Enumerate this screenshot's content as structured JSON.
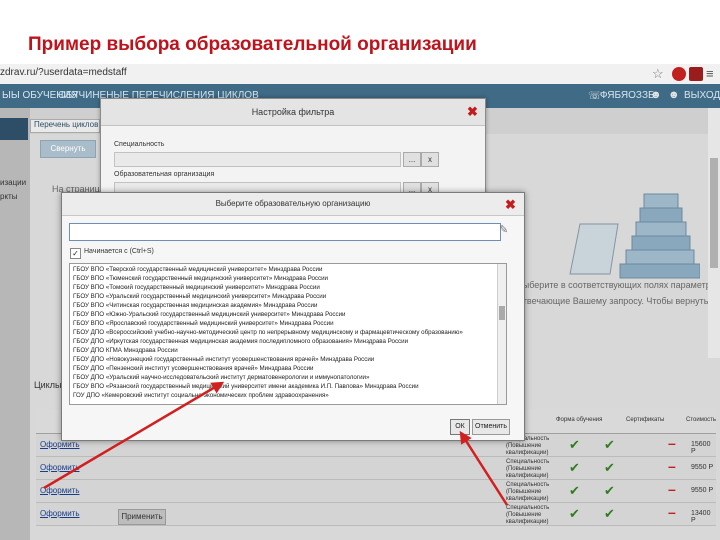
{
  "slide": {
    "title": "Пример выбора образовательной организации"
  },
  "browser": {
    "url": "zdrav.ru/?userdata=medstaff",
    "star_icon": "star-icon",
    "menu_icon": "menu-icon"
  },
  "nav": {
    "items": [
      "ЫЫ ОБУЧЕНИЯ",
      "ОБУЧИНЕНЫЕ ПЕРЕЧИСЛЕНИЯ ЦИКЛОВ"
    ],
    "user_text": "ФЯБЯОЗЗБ",
    "exit_label": "ВЫХОД"
  },
  "left_sidebar": {
    "items": [
      "изации",
      "ркты"
    ]
  },
  "background": {
    "tab_label": "Перечень циклов п",
    "collapse_button": "Свернуть",
    "intro_text": "На странице",
    "right_text_1": "выберите в соответствующих полях параметры,",
    "right_text_2": "отвечающие Вашему запросу. Чтобы вернуться к",
    "cycles_label": "Циклы",
    "apply_button": "Применить"
  },
  "table": {
    "headers": [
      "Форма обучения",
      "Сертификаты",
      "Стоимость"
    ],
    "rows": [
      {
        "link": "Оформить",
        "desc": "Специальность (Повышение квалификации)",
        "price": "15600 Р"
      },
      {
        "link": "Оформить",
        "desc": "Специальность (Повышение квалификации)",
        "price": "9550 Р"
      },
      {
        "link": "Оформить",
        "desc": "Специальность (Повышение квалификации)",
        "price": "9550 Р"
      },
      {
        "link": "Оформить",
        "desc": "Специальность (Повышение квалификации)",
        "price": "13400 Р"
      }
    ]
  },
  "filter_dialog": {
    "title": "Настройка фильтра",
    "fields": [
      {
        "label": "Специальность",
        "browse": "...",
        "clear": "x"
      },
      {
        "label": "Образовательная организация",
        "browse": "...",
        "clear": "x"
      }
    ]
  },
  "org_dialog": {
    "title": "Выберите образовательную организацию",
    "search_value": "",
    "starts_with_label": "Начинается с (Ctrl+S)",
    "starts_with_checked": true,
    "items": [
      "ГБОУ ВПО «Тверской государственный медицинский университет» Минздрава России",
      "ГБОУ ВПО «Тюменский государственный медицинский университет» Минздрава России",
      "ГБОУ ВПО «Томский государственный медицинский университет» Минздрава России",
      "ГБОУ ВПО «Уральский государственный медицинский университет» Минздрава России",
      "ГБОУ ВПО «Читинская государственная медицинская академия» Минздрава России",
      "ГБОУ ВПО «Южно-Уральский государственный медицинский университет» Минздрава России",
      "ГБОУ ВПО «Ярославский государственный медицинский университет» Минздрава России",
      "ГБОУ ДПО «Всероссийский учебно-научно-методический центр по непрерывному медицинскому и фармацевтическому образованию»",
      "ГБОУ ДПО «Иркутская государственная медицинская академия последипломного образования» Минздрава России",
      "ГБОУ ДПО КГМА Минздрава России",
      "ГБОУ ДПО «Новокузнецкий государственный институт усовершенствования врачей» Минздрава России",
      "ГБОУ ДПО «Пензенский институт усовершенствования врачей» Минздрава России",
      "ГБОУ ДПО «Уральский научно-исследовательский институт дерматовенерологии и иммунопатологии»",
      "ГБОУ ВПО «Рязанский государственный медицинский университет имени академика И.П. Павлова» Минздрава России",
      "ГОУ ДПО «Кемеровский институт социально-экономических проблем здравоохранения»"
    ],
    "ok_label": "ОК",
    "cancel_label": "Отменить"
  },
  "colors": {
    "title": "#c0121b",
    "nav": "#3f6b86",
    "close": "#c41c1c",
    "arrow": "#d0201f",
    "check": "#2f7d1f"
  }
}
